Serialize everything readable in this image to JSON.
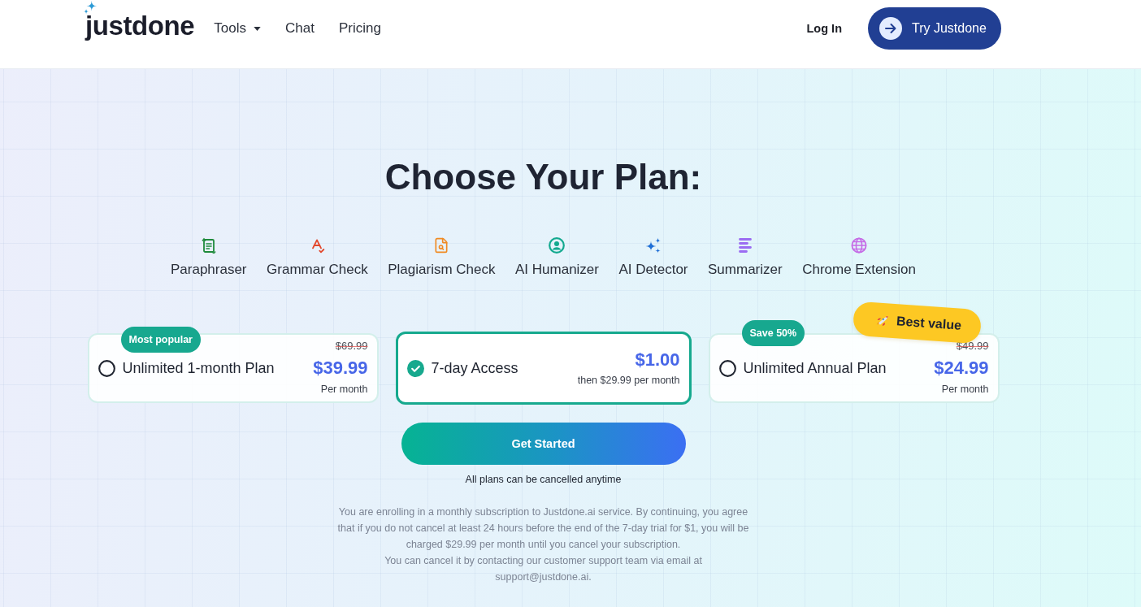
{
  "header": {
    "logo": "justdone",
    "nav": [
      {
        "label": "Tools",
        "kind": "dropdown"
      },
      {
        "label": "Chat",
        "kind": "link"
      },
      {
        "label": "Pricing",
        "kind": "link"
      }
    ],
    "login": "Log In",
    "cta": "Try Justdone"
  },
  "title": "Choose Your Plan:",
  "tools": [
    {
      "label": "Paraphraser",
      "color": "#1f8a3c"
    },
    {
      "label": "Grammar Check",
      "color": "#e2482d"
    },
    {
      "label": "Plagiarism Check",
      "color": "#f08a22"
    },
    {
      "label": "AI Humanizer",
      "color": "#13a98f"
    },
    {
      "label": "AI Detector",
      "color": "#1f6fd6"
    },
    {
      "label": "Summarizer",
      "color": "#9b6cf2"
    },
    {
      "label": "Chrome Extension",
      "color": "#c56be6"
    }
  ],
  "plans": [
    {
      "name": "Unlimited 1-month Plan",
      "selected": false,
      "badge": "Most popular",
      "old_price": "$69.99",
      "price": "$39.99",
      "period": "Per month"
    },
    {
      "name": "7-day Access",
      "selected": true,
      "price": "$1.00",
      "period": "then $29.99 per month"
    },
    {
      "name": "Unlimited Annual Plan",
      "selected": false,
      "badge": "Save 50%",
      "ribbon": "Best value",
      "old_price": "$49.99",
      "price": "$24.99",
      "period": "Per month"
    }
  ],
  "button": "Get Started",
  "note": "All plans can be cancelled anytime",
  "disclaimer": [
    "You are enrolling in a monthly subscription to Justdone.ai service. By continuing, you agree that if you do not cancel at least 24 hours before the end of the 7-day trial for $1, you will be charged $29.99 per month until you cancel your subscription.",
    "You can cancel it by contacting our customer support team via email at support@justdone.ai."
  ]
}
